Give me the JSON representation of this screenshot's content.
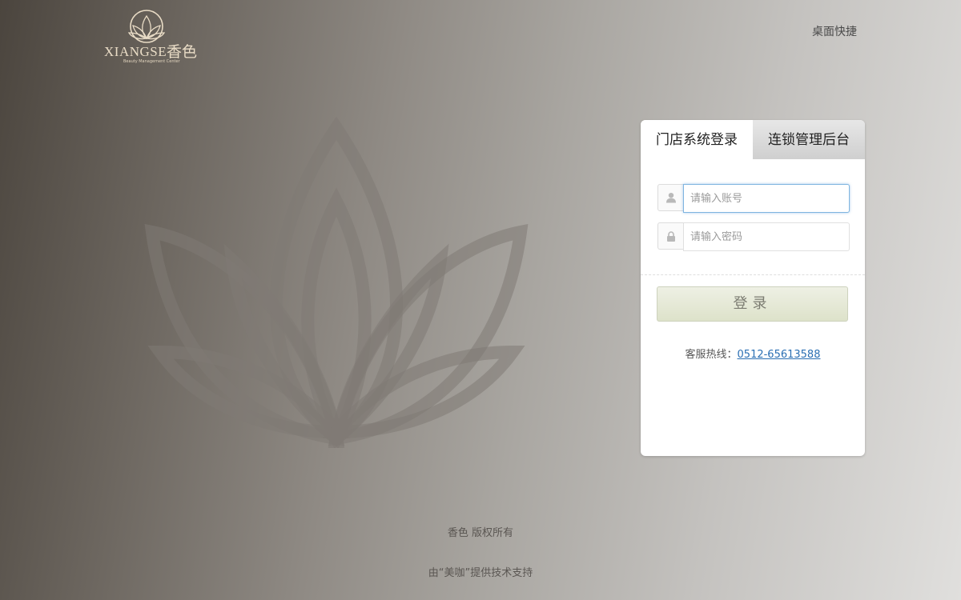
{
  "logo": {
    "text": "XIANGSE",
    "cn": "香色",
    "tagline": "Beauty Management Center",
    "color": "#e9dcc6"
  },
  "header": {
    "shortcut": "桌面快捷"
  },
  "login": {
    "tabs": [
      {
        "label": "门店系统登录",
        "active": true
      },
      {
        "label": "连锁管理后台",
        "active": false
      }
    ],
    "account": {
      "value": "",
      "placeholder": "请输入账号",
      "icon": "user-icon"
    },
    "password": {
      "value": "",
      "placeholder": "请输入密码",
      "icon": "lock-icon"
    },
    "submit_label": "登录",
    "hotline_label": "客服热线：",
    "hotline_number": "0512-65613588"
  },
  "footer": {
    "copyright": "香色 版权所有",
    "support": "由“美咖”提供技术支持"
  },
  "colors": {
    "accent_link": "#2a6fb3",
    "button_bg": "#e4e8d4",
    "focus_border": "#7fb5e0"
  }
}
